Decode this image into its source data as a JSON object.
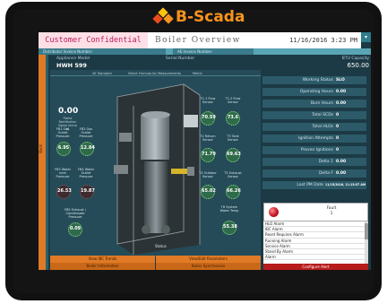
{
  "brand": {
    "name": "B-Scada",
    "colors": {
      "orange": "#f7941d",
      "yellow": "#ffc20e",
      "red": "#e84c1e",
      "teal": "#1c3a45",
      "accent": "#e07a26"
    }
  },
  "header": {
    "confidential": "Customer Confidential",
    "title": "Boiler Overview",
    "datetime": "11/16/2016 3:23 PM",
    "menu_icon": "chevron-down-icon"
  },
  "subheader": {
    "distributor_label": "Distributor Invoice Number:",
    "ae_label": "AE Invoice Number:"
  },
  "sidebar": {
    "label": "Back"
  },
  "appliance": {
    "model_label": "Appliance Model",
    "model_value": "HWH 599",
    "serial_label": "Serial Number",
    "capacity_label": "BTU Capacity",
    "capacity_value": "650.00"
  },
  "diagram": {
    "hdr_left": "AE Standard",
    "hdr_center": "Select Formula for Measurements",
    "hdr_right": "Metric",
    "flame_value": "0.00",
    "flame_label": "Flame Rectification Signal (micro A)",
    "status_label": "Status",
    "sensors": [
      {
        "label": "FB1 Gas Outlet Pressure",
        "value": "6.95",
        "state": "green"
      },
      {
        "label": "FB2 Gas Outlet Pressure",
        "value": "12.84",
        "state": "green"
      },
      {
        "label": "FB3 Water Inlet Pressure",
        "value": "26.53",
        "state": "dark"
      },
      {
        "label": "FB4 Water Outlet Pressure",
        "value": "19.87",
        "state": "dark"
      },
      {
        "label": "FB5 Exhaust / Condensate Pressure",
        "value": "0.09",
        "state": "green"
      },
      {
        "label": "T1.1 Flow Sensor",
        "value": "70.59",
        "state": "green"
      },
      {
        "label": "T1.2 Flow Sensor",
        "value": "73.6",
        "state": "green"
      },
      {
        "label": "T2 Return Sensor",
        "value": "71.79",
        "state": "green"
      },
      {
        "label": "T3 Tank Sensor",
        "value": "69.63",
        "state": "green"
      },
      {
        "label": "T4 Outdoor Sensor",
        "value": "65.02",
        "state": "green"
      },
      {
        "label": "T5 Exhaust Sensor",
        "value": "66.26",
        "state": "green"
      },
      {
        "label": "T6 System Water Temp",
        "value": "55.38",
        "state": "green"
      }
    ]
  },
  "buttons": {
    "view_ibc_trends": "View IBC Trends",
    "view_edit_params": "View/Edit Parameters",
    "boiler_information": "Boiler Information",
    "boiler_synchronize": "Boiler Synchronize",
    "configure_alert": "Configure Alert"
  },
  "status_panel": {
    "rows": [
      {
        "label": "Working Status",
        "value": "SLO"
      },
      {
        "label": "Operating Hours",
        "value": "0.00"
      },
      {
        "label": "Burn Hours",
        "value": "0.00"
      },
      {
        "label": "Total SCDs",
        "value": "0"
      },
      {
        "label": "Total HLOs",
        "value": "0"
      },
      {
        "label": "Ignition Attempts",
        "value": "0"
      },
      {
        "label": "Proven Ignitions",
        "value": "0"
      },
      {
        "label": "Delta 1",
        "value": "0.00"
      },
      {
        "label": "Delta F",
        "value": "0.00"
      },
      {
        "label": "Last PM Date",
        "value": "11/15/2016, 11:15:57 AM"
      }
    ]
  },
  "fault": {
    "title": "Fault",
    "count": "1",
    "alarms": [
      "HLO Alarm",
      "IBC Alarm",
      "Reset Requires Alarm",
      "Running Alarm",
      "Service Alarm",
      "Stand By Alarm",
      "Alarm"
    ]
  }
}
